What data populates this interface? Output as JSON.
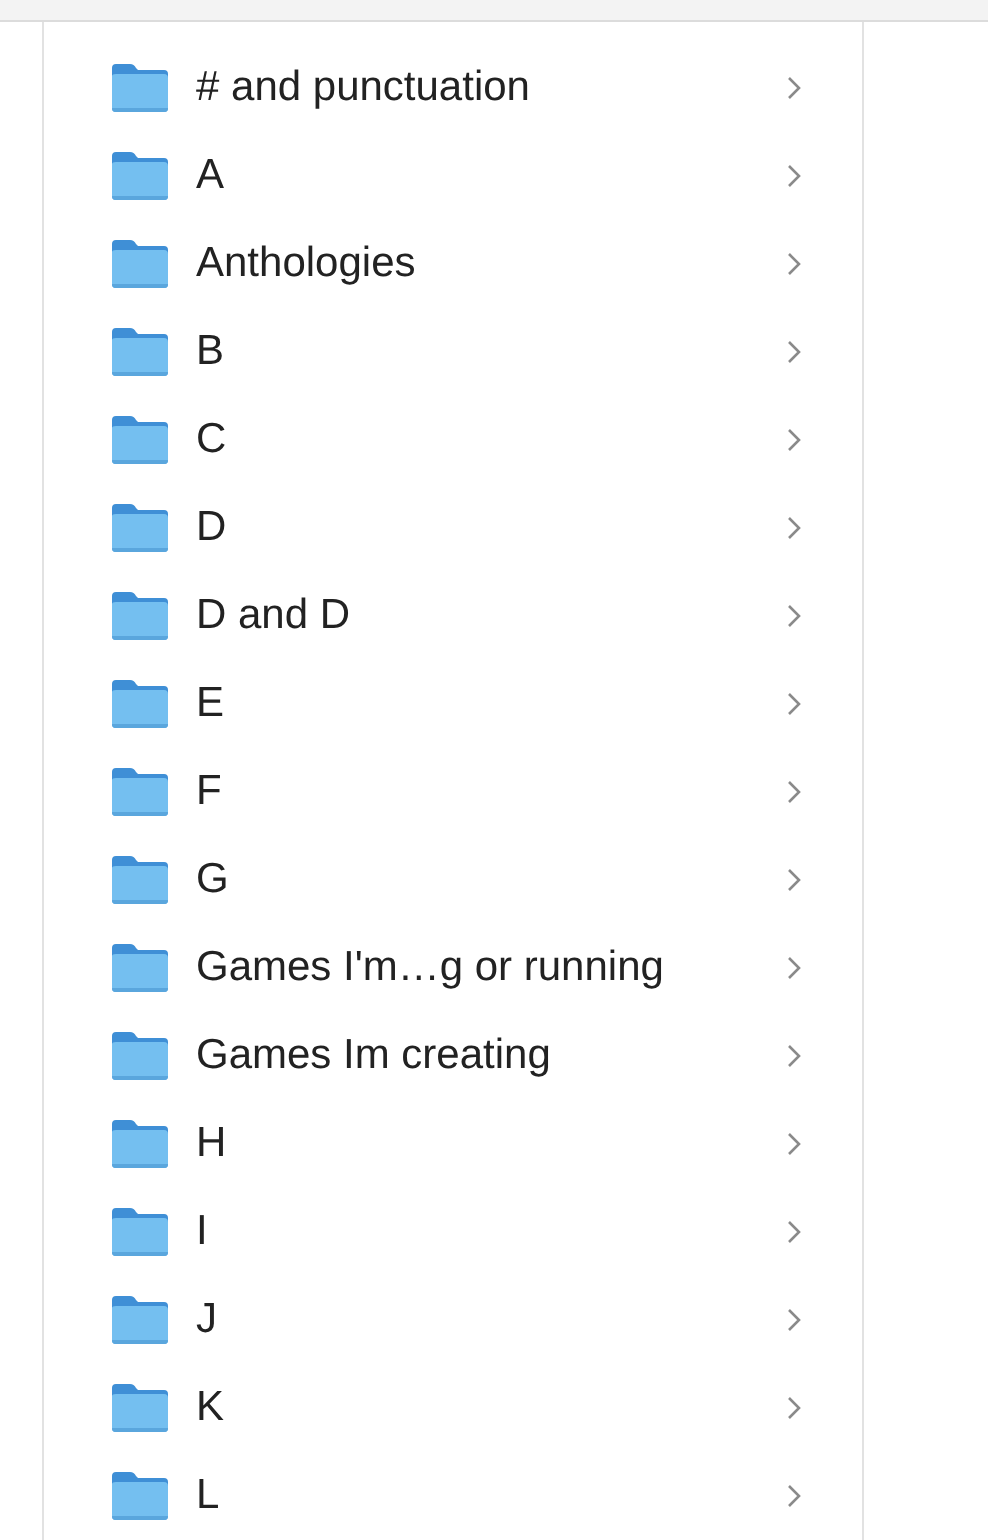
{
  "folders": [
    {
      "name": "# and punctuation"
    },
    {
      "name": "A"
    },
    {
      "name": "Anthologies"
    },
    {
      "name": "B"
    },
    {
      "name": "C"
    },
    {
      "name": "D"
    },
    {
      "name": "D and D"
    },
    {
      "name": "E"
    },
    {
      "name": "F"
    },
    {
      "name": "G"
    },
    {
      "name": "Games I'm…g or running"
    },
    {
      "name": "Games Im creating"
    },
    {
      "name": "H"
    },
    {
      "name": "I"
    },
    {
      "name": "J"
    },
    {
      "name": "K"
    },
    {
      "name": "L"
    }
  ]
}
